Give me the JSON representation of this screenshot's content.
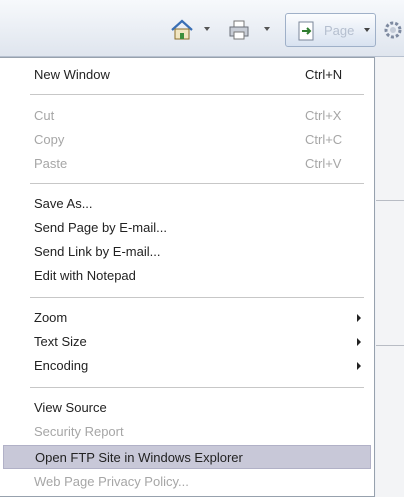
{
  "toolbar": {
    "page_label": "Page"
  },
  "menu": {
    "new_window": {
      "label": "New Window",
      "shortcut": "Ctrl+N"
    },
    "cut": {
      "label": "Cut",
      "shortcut": "Ctrl+X"
    },
    "copy": {
      "label": "Copy",
      "shortcut": "Ctrl+C"
    },
    "paste": {
      "label": "Paste",
      "shortcut": "Ctrl+V"
    },
    "save_as": {
      "label": "Save As..."
    },
    "send_page": {
      "label": "Send Page by E-mail..."
    },
    "send_link": {
      "label": "Send Link by E-mail..."
    },
    "edit_notepad": {
      "label": "Edit with Notepad"
    },
    "zoom": {
      "label": "Zoom"
    },
    "text_size": {
      "label": "Text Size"
    },
    "encoding": {
      "label": "Encoding"
    },
    "view_source": {
      "label": "View Source"
    },
    "security_report": {
      "label": "Security Report"
    },
    "open_ftp": {
      "label": "Open FTP Site in Windows Explorer"
    },
    "privacy_policy": {
      "label": "Web Page Privacy Policy..."
    }
  }
}
